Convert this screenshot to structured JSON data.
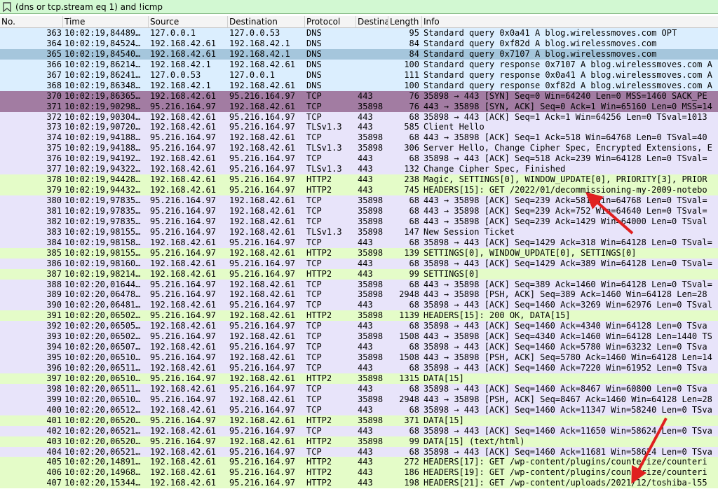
{
  "filter": {
    "value": "(dns or tcp.stream eq 1) and !icmp",
    "icon": "bookmark-filter-icon"
  },
  "columns": [
    "No.",
    "Time",
    "Source",
    "Destination",
    "Protocol",
    "Destina",
    "Length",
    "Info"
  ],
  "row_colors": {
    "dns": "#dbeefe",
    "selected": "#a5c6dc",
    "syn": "#a27ca2",
    "tcp": "#e8e4fa",
    "http2": "#e4fcc8"
  },
  "annotation_color": "#e02020",
  "rows": [
    {
      "no": "363",
      "time": "10:02:19,84489…",
      "src": "127.0.0.1",
      "dst": "127.0.0.53",
      "proto": "DNS",
      "dport": "",
      "len": "95",
      "info": "Standard query 0x0a41 A blog.wirelessmoves.com OPT",
      "kind": "dns"
    },
    {
      "no": "364",
      "time": "10:02:19,84524…",
      "src": "192.168.42.61",
      "dst": "192.168.42.1",
      "proto": "DNS",
      "dport": "",
      "len": "84",
      "info": "Standard query 0xf82d A blog.wirelessmoves.com",
      "kind": "dns"
    },
    {
      "no": "365",
      "time": "10:02:19,84540…",
      "src": "192.168.42.61",
      "dst": "192.168.42.1",
      "proto": "DNS",
      "dport": "",
      "len": "84",
      "info": "Standard query 0x7107 A blog.wirelessmoves.com",
      "kind": "selected"
    },
    {
      "no": "366",
      "time": "10:02:19,86214…",
      "src": "192.168.42.1",
      "dst": "192.168.42.61",
      "proto": "DNS",
      "dport": "",
      "len": "100",
      "info": "Standard query response 0x7107 A blog.wirelessmoves.com A",
      "kind": "dns"
    },
    {
      "no": "367",
      "time": "10:02:19,86241…",
      "src": "127.0.0.53",
      "dst": "127.0.0.1",
      "proto": "DNS",
      "dport": "",
      "len": "111",
      "info": "Standard query response 0x0a41 A blog.wirelessmoves.com A",
      "kind": "dns"
    },
    {
      "no": "368",
      "time": "10:02:19,86348…",
      "src": "192.168.42.1",
      "dst": "192.168.42.61",
      "proto": "DNS",
      "dport": "",
      "len": "100",
      "info": "Standard query response 0xf82d A blog.wirelessmoves.com A",
      "kind": "dns"
    },
    {
      "no": "370",
      "time": "10:02:19,86365…",
      "src": "192.168.42.61",
      "dst": "95.216.164.97",
      "proto": "TCP",
      "dport": "443",
      "len": "76",
      "info": "35898 → 443 [SYN] Seq=0 Win=64240 Len=0 MSS=1460 SACK_PE",
      "kind": "syn"
    },
    {
      "no": "371",
      "time": "10:02:19,90298…",
      "src": "95.216.164.97",
      "dst": "192.168.42.61",
      "proto": "TCP",
      "dport": "35898",
      "len": "76",
      "info": "443 → 35898 [SYN, ACK] Seq=0 Ack=1 Win=65160 Len=0 MSS=14",
      "kind": "syn"
    },
    {
      "no": "372",
      "time": "10:02:19,90304…",
      "src": "192.168.42.61",
      "dst": "95.216.164.97",
      "proto": "TCP",
      "dport": "443",
      "len": "68",
      "info": "35898 → 443 [ACK] Seq=1 Ack=1 Win=64256 Len=0 TSval=1013",
      "kind": "tcp"
    },
    {
      "no": "373",
      "time": "10:02:19,90720…",
      "src": "192.168.42.61",
      "dst": "95.216.164.97",
      "proto": "TLSv1.3",
      "dport": "443",
      "len": "585",
      "info": "Client Hello",
      "kind": "tcp"
    },
    {
      "no": "374",
      "time": "10:02:19,94188…",
      "src": "95.216.164.97",
      "dst": "192.168.42.61",
      "proto": "TCP",
      "dport": "35898",
      "len": "68",
      "info": "443 → 35898 [ACK] Seq=1 Ack=518 Win=64768 Len=0 TSval=40",
      "kind": "tcp"
    },
    {
      "no": "375",
      "time": "10:02:19,94188…",
      "src": "95.216.164.97",
      "dst": "192.168.42.61",
      "proto": "TLSv1.3",
      "dport": "35898",
      "len": "306",
      "info": "Server Hello, Change Cipher Spec, Encrypted Extensions, E",
      "kind": "tcp"
    },
    {
      "no": "376",
      "time": "10:02:19,94192…",
      "src": "192.168.42.61",
      "dst": "95.216.164.97",
      "proto": "TCP",
      "dport": "443",
      "len": "68",
      "info": "35898 → 443 [ACK] Seq=518 Ack=239 Win=64128 Len=0 TSval=",
      "kind": "tcp"
    },
    {
      "no": "377",
      "time": "10:02:19,94322…",
      "src": "192.168.42.61",
      "dst": "95.216.164.97",
      "proto": "TLSv1.3",
      "dport": "443",
      "len": "132",
      "info": "Change Cipher Spec, Finished",
      "kind": "tcp"
    },
    {
      "no": "378",
      "time": "10:02:19,94428…",
      "src": "192.168.42.61",
      "dst": "95.216.164.97",
      "proto": "HTTP2",
      "dport": "443",
      "len": "238",
      "info": "Magic, SETTINGS[0], WINDOW_UPDATE[0], PRIORITY[3], PRIOR",
      "kind": "http2"
    },
    {
      "no": "379",
      "time": "10:02:19,94432…",
      "src": "192.168.42.61",
      "dst": "95.216.164.97",
      "proto": "HTTP2",
      "dport": "443",
      "len": "745",
      "info": "HEADERS[15]: GET /2022/01/decommissioning-my-2009-notebo",
      "kind": "http2"
    },
    {
      "no": "380",
      "time": "10:02:19,97835…",
      "src": "95.216.164.97",
      "dst": "192.168.42.61",
      "proto": "TCP",
      "dport": "35898",
      "len": "68",
      "info": "443 → 35898 [ACK] Seq=239 Ack=581 Win=64768 Len=0 TSval=",
      "kind": "tcp"
    },
    {
      "no": "381",
      "time": "10:02:19,97835…",
      "src": "95.216.164.97",
      "dst": "192.168.42.61",
      "proto": "TCP",
      "dport": "35898",
      "len": "68",
      "info": "443 → 35898 [ACK] Seq=239 Ack=752 Win=64640 Len=0 TSval=",
      "kind": "tcp"
    },
    {
      "no": "382",
      "time": "10:02:19,97835…",
      "src": "95.216.164.97",
      "dst": "192.168.42.61",
      "proto": "TCP",
      "dport": "35898",
      "len": "68",
      "info": "443 → 35898 [ACK] Seq=239 Ack=1429 Win=64000 Len=0 TSval",
      "kind": "tcp"
    },
    {
      "no": "383",
      "time": "10:02:19,98155…",
      "src": "95.216.164.97",
      "dst": "192.168.42.61",
      "proto": "TLSv1.3",
      "dport": "35898",
      "len": "147",
      "info": "New Session Ticket",
      "kind": "tcp"
    },
    {
      "no": "384",
      "time": "10:02:19,98158…",
      "src": "192.168.42.61",
      "dst": "95.216.164.97",
      "proto": "TCP",
      "dport": "443",
      "len": "68",
      "info": "35898 → 443 [ACK] Seq=1429 Ack=318 Win=64128 Len=0 TSval=",
      "kind": "tcp"
    },
    {
      "no": "385",
      "time": "10:02:19,98155…",
      "src": "95.216.164.97",
      "dst": "192.168.42.61",
      "proto": "HTTP2",
      "dport": "35898",
      "len": "139",
      "info": "SETTINGS[0], WINDOW_UPDATE[0], SETTINGS[0]",
      "kind": "http2"
    },
    {
      "no": "386",
      "time": "10:02:19,98160…",
      "src": "192.168.42.61",
      "dst": "95.216.164.97",
      "proto": "TCP",
      "dport": "443",
      "len": "68",
      "info": "35898 → 443 [ACK] Seq=1429 Ack=389 Win=64128 Len=0 TSval=",
      "kind": "tcp"
    },
    {
      "no": "387",
      "time": "10:02:19,98214…",
      "src": "192.168.42.61",
      "dst": "95.216.164.97",
      "proto": "HTTP2",
      "dport": "443",
      "len": "99",
      "info": "SETTINGS[0]",
      "kind": "http2"
    },
    {
      "no": "388",
      "time": "10:02:20,01644…",
      "src": "95.216.164.97",
      "dst": "192.168.42.61",
      "proto": "TCP",
      "dport": "35898",
      "len": "68",
      "info": "443 → 35898 [ACK] Seq=389 Ack=1460 Win=64128 Len=0 TSval=",
      "kind": "tcp"
    },
    {
      "no": "389",
      "time": "10:02:20,06478…",
      "src": "95.216.164.97",
      "dst": "192.168.42.61",
      "proto": "TCP",
      "dport": "35898",
      "len": "2948",
      "info": "443 → 35898 [PSH, ACK] Seq=389 Ack=1460 Win=64128 Len=28",
      "kind": "tcp"
    },
    {
      "no": "390",
      "time": "10:02:20,06481…",
      "src": "192.168.42.61",
      "dst": "95.216.164.97",
      "proto": "TCP",
      "dport": "443",
      "len": "68",
      "info": "35898 → 443 [ACK] Seq=1460 Ack=3269 Win=62976 Len=0 TSval",
      "kind": "tcp"
    },
    {
      "no": "391",
      "time": "10:02:20,06502…",
      "src": "95.216.164.97",
      "dst": "192.168.42.61",
      "proto": "HTTP2",
      "dport": "35898",
      "len": "1139",
      "info": "HEADERS[15]: 200 OK, DATA[15]",
      "kind": "http2"
    },
    {
      "no": "392",
      "time": "10:02:20,06505…",
      "src": "192.168.42.61",
      "dst": "95.216.164.97",
      "proto": "TCP",
      "dport": "443",
      "len": "68",
      "info": "35898 → 443 [ACK] Seq=1460 Ack=4340 Win=64128 Len=0 TSva",
      "kind": "tcp"
    },
    {
      "no": "393",
      "time": "10:02:20,06502…",
      "src": "95.216.164.97",
      "dst": "192.168.42.61",
      "proto": "TCP",
      "dport": "35898",
      "len": "1508",
      "info": "443 → 35898 [ACK] Seq=4340 Ack=1460 Win=64128 Len=1440 TS",
      "kind": "tcp"
    },
    {
      "no": "394",
      "time": "10:02:20,06507…",
      "src": "192.168.42.61",
      "dst": "95.216.164.97",
      "proto": "TCP",
      "dport": "443",
      "len": "68",
      "info": "35898 → 443 [ACK] Seq=1460 Ack=5780 Win=63232 Len=0 TSva",
      "kind": "tcp"
    },
    {
      "no": "395",
      "time": "10:02:20,06510…",
      "src": "95.216.164.97",
      "dst": "192.168.42.61",
      "proto": "TCP",
      "dport": "35898",
      "len": "1508",
      "info": "443 → 35898 [PSH, ACK] Seq=5780 Ack=1460 Win=64128 Len=14",
      "kind": "tcp"
    },
    {
      "no": "396",
      "time": "10:02:20,06511…",
      "src": "192.168.42.61",
      "dst": "95.216.164.97",
      "proto": "TCP",
      "dport": "443",
      "len": "68",
      "info": "35898 → 443 [ACK] Seq=1460 Ack=7220 Win=61952 Len=0 TSva",
      "kind": "tcp"
    },
    {
      "no": "397",
      "time": "10:02:20,06510…",
      "src": "95.216.164.97",
      "dst": "192.168.42.61",
      "proto": "HTTP2",
      "dport": "35898",
      "len": "1315",
      "info": "DATA[15]",
      "kind": "http2"
    },
    {
      "no": "398",
      "time": "10:02:20,06511…",
      "src": "192.168.42.61",
      "dst": "95.216.164.97",
      "proto": "TCP",
      "dport": "443",
      "len": "68",
      "info": "35898 → 443 [ACK] Seq=1460 Ack=8467 Win=60800 Len=0 TSva",
      "kind": "tcp"
    },
    {
      "no": "399",
      "time": "10:02:20,06510…",
      "src": "95.216.164.97",
      "dst": "192.168.42.61",
      "proto": "TCP",
      "dport": "35898",
      "len": "2948",
      "info": "443 → 35898 [PSH, ACK] Seq=8467 Ack=1460 Win=64128 Len=28",
      "kind": "tcp"
    },
    {
      "no": "400",
      "time": "10:02:20,06512…",
      "src": "192.168.42.61",
      "dst": "95.216.164.97",
      "proto": "TCP",
      "dport": "443",
      "len": "68",
      "info": "35898 → 443 [ACK] Seq=1460 Ack=11347 Win=58240 Len=0 TSva",
      "kind": "tcp"
    },
    {
      "no": "401",
      "time": "10:02:20,06520…",
      "src": "95.216.164.97",
      "dst": "192.168.42.61",
      "proto": "HTTP2",
      "dport": "35898",
      "len": "371",
      "info": "DATA[15]",
      "kind": "http2"
    },
    {
      "no": "402",
      "time": "10:02:20,06521…",
      "src": "192.168.42.61",
      "dst": "95.216.164.97",
      "proto": "TCP",
      "dport": "443",
      "len": "68",
      "info": "35898 → 443 [ACK] Seq=1460 Ack=11650 Win=58624 Len=0 TSva",
      "kind": "tcp"
    },
    {
      "no": "403",
      "time": "10:02:20,06520…",
      "src": "95.216.164.97",
      "dst": "192.168.42.61",
      "proto": "HTTP2",
      "dport": "35898",
      "len": "99",
      "info": "DATA[15] (text/html)",
      "kind": "http2"
    },
    {
      "no": "404",
      "time": "10:02:20,06521…",
      "src": "192.168.42.61",
      "dst": "95.216.164.97",
      "proto": "TCP",
      "dport": "443",
      "len": "68",
      "info": "35898 → 443 [ACK] Seq=1460 Ack=11681 Win=58624 Len=0 TSva",
      "kind": "tcp"
    },
    {
      "no": "405",
      "time": "10:02:20,14891…",
      "src": "192.168.42.61",
      "dst": "95.216.164.97",
      "proto": "HTTP2",
      "dport": "443",
      "len": "272",
      "info": "HEADERS[17]: GET /wp-content/plugins/counterize/counteri",
      "kind": "http2"
    },
    {
      "no": "406",
      "time": "10:02:20,14968…",
      "src": "192.168.42.61",
      "dst": "95.216.164.97",
      "proto": "HTTP2",
      "dport": "443",
      "len": "186",
      "info": "HEADERS[19]: GET /wp-content/plugins/counterize/counteri",
      "kind": "http2"
    },
    {
      "no": "407",
      "time": "10:02:20,15344…",
      "src": "192.168.42.61",
      "dst": "95.216.164.97",
      "proto": "HTTP2",
      "dport": "443",
      "len": "198",
      "info": "HEADERS[21]: GET /wp-content/uploads/2021/12/toshiba-l55",
      "kind": "http2"
    }
  ]
}
